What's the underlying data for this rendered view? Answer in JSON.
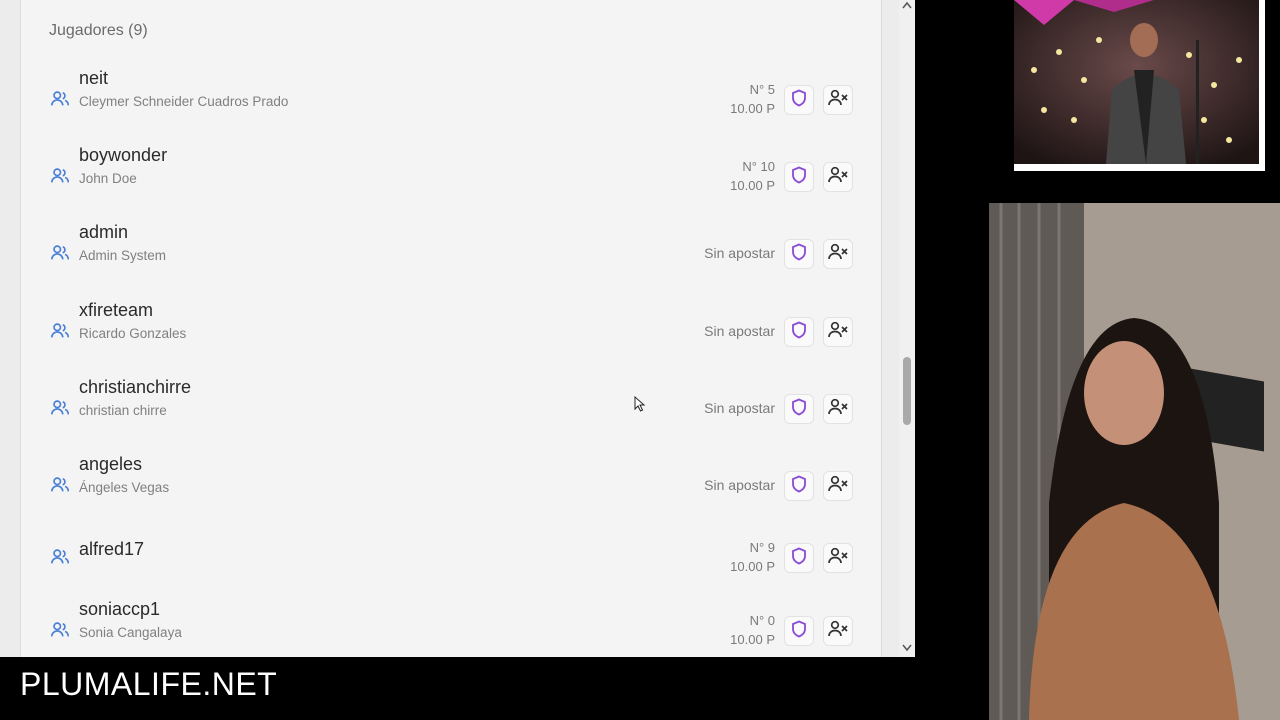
{
  "players": {
    "title": "Jugadores (9)",
    "rows": [
      {
        "username": "neit",
        "full_name": "Cleymer Schneider Cuadros Prado",
        "number": "N° 5",
        "amount": "10.00 P",
        "status": ""
      },
      {
        "username": "boywonder",
        "full_name": "John Doe",
        "number": "N° 10",
        "amount": "10.00 P",
        "status": ""
      },
      {
        "username": "admin",
        "full_name": "Admin System",
        "number": "",
        "amount": "",
        "status": "Sin apostar"
      },
      {
        "username": "xfireteam",
        "full_name": "Ricardo Gonzales",
        "number": "",
        "amount": "",
        "status": "Sin apostar"
      },
      {
        "username": "christianchirre",
        "full_name": "christian chirre",
        "number": "",
        "amount": "",
        "status": "Sin apostar"
      },
      {
        "username": "angeles",
        "full_name": "Ángeles Vegas",
        "number": "",
        "amount": "",
        "status": "Sin apostar"
      },
      {
        "username": "alfred17",
        "full_name": "",
        "number": "N° 9",
        "amount": "10.00 P",
        "status": ""
      },
      {
        "username": "soniaccp1",
        "full_name": "Sonia Cangalaya",
        "number": "N° 0",
        "amount": "10.00 P",
        "status": ""
      }
    ]
  },
  "brand": {
    "text": "PLUMALIFE.NET"
  },
  "colors": {
    "accent_purple": "#8a4bd6",
    "icon_blue": "#4a7fd6",
    "kick_icon": "#333333"
  },
  "icons": {
    "user": "users-icon",
    "shield": "shield-icon",
    "kick": "user-remove-icon"
  }
}
